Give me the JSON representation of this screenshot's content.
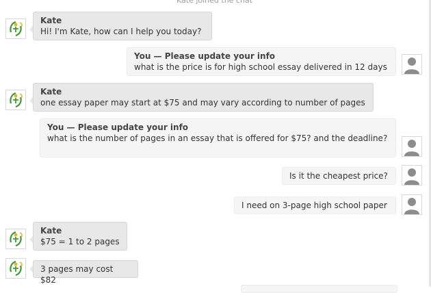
{
  "system_message": "Kate joined the chat",
  "messages": [
    {
      "from": "agent",
      "name": "Kate",
      "text": "Hi! I'm Kate, how can I help you today?"
    },
    {
      "from": "user",
      "name": "You — Please update your info",
      "text": "what is the price is for high school essay delivered in 12 days"
    },
    {
      "from": "agent",
      "name": "Kate",
      "text": "one essay paper may start at $75 and may vary according to number of pages"
    },
    {
      "from": "user",
      "name": "You — Please update your info",
      "text": "what is the number of pages in an essay that is offered for $75? and the deadline?"
    },
    {
      "from": "user",
      "name": "",
      "text": "Is it the cheapest price?"
    },
    {
      "from": "user",
      "name": "",
      "text": "I need on 3-page high school paper"
    },
    {
      "from": "agent",
      "name": "Kate",
      "text": "$75 = 1 to 2 pages"
    },
    {
      "from": "agent",
      "name": "",
      "text": "3 pages may cost $82"
    }
  ],
  "colors": {
    "agent_bubble": "#e8e8e8",
    "user_bubble": "#f5f5f5",
    "agent_logo_green": "#3c9b2e",
    "agent_logo_yellow": "#e0b726",
    "user_avatar_gray": "#8c8c8c"
  }
}
